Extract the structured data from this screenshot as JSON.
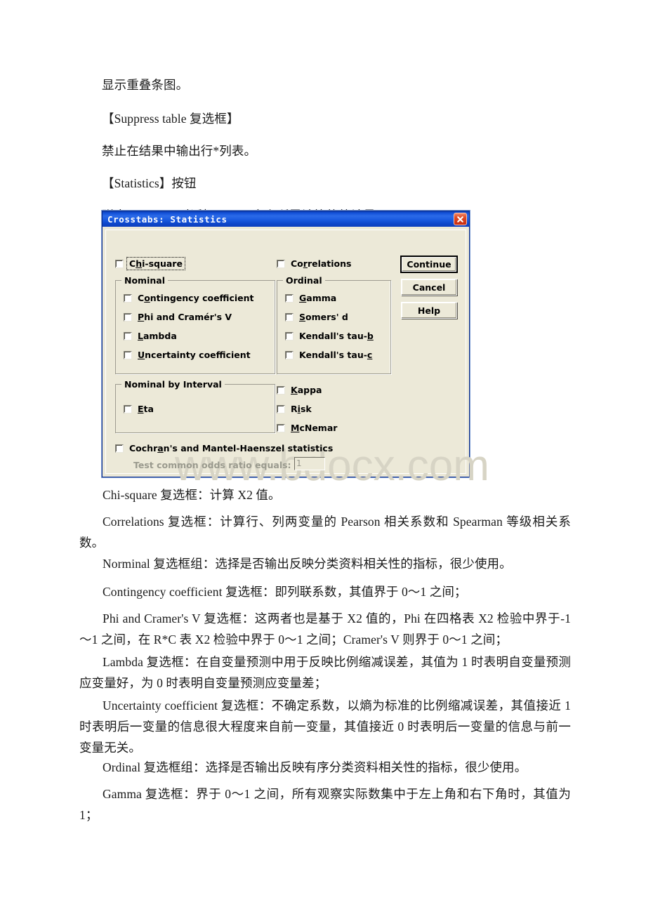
{
  "document": {
    "paragraphs": [
      {
        "text": "显示重叠条图。"
      },
      {
        "text": "【Suppress table 复选框】"
      },
      {
        "text": "禁止在结果中输出行*列表。"
      },
      {
        "text": "【Statistics】按钮"
      },
      {
        "text": "弹出 Statistics 对话框，用于定义所需计算的统计量。"
      },
      {
        "text": "Chi-square 复选框：计算 X2 值。"
      },
      {
        "text": "Correlations 复选框：计算行、列两变量的 Pearson 相关系数和 Spearman 等级相关系数。"
      },
      {
        "text": "Norminal 复选框组：选择是否输出反映分类资料相关性的指标，很少使用。"
      },
      {
        "text": "Contingency coefficient 复选框：即列联系数，其值界于 0～1 之间；"
      },
      {
        "text": "Phi and Cramer's V 复选框：这两者也是基于 X2 值的，Phi 在四格表 X2 检验中界于-1～1 之间，在 R*C 表 X2 检验中界于 0～1 之间；Cramer's V 则界于 0～1 之间；"
      },
      {
        "text": "Lambda 复选框：在自变量预测中用于反映比例缩减误差，其值为 1 时表明自变量预测应变量好，为 0 时表明自变量预测应变量差；"
      },
      {
        "text": "Uncertainty coefficient 复选框：不确定系数，以熵为标准的比例缩减误差，其值接近 1 时表明后一变量的信息很大程度来自前一变量，其值接近 0 时表明后一变量的信息与前一变量无关。"
      },
      {
        "text": "Ordinal 复选框组：选择是否输出反映有序分类资料相关性的指标，很少使用。"
      },
      {
        "text": "Gamma 复选框：界于 0～1 之间，所有观察实际数集中于左上角和右下角时，其值为 1；"
      }
    ]
  },
  "watermark": {
    "text": "www.bdocx.com"
  },
  "dialog": {
    "title": "Crosstabs: Statistics",
    "close_icon": "close-icon",
    "checkboxes": {
      "chi_square": "Chi-square",
      "correlations": "Correlations",
      "kappa": "Kappa",
      "risk": "Risk",
      "mcnemar": "McNemar",
      "cochran": "Cochran's and Mantel-Haenszel statistics"
    },
    "groups": {
      "nominal": {
        "title": "Nominal",
        "items": [
          "Contingency coefficient",
          "Phi and Cramér's V",
          "Lambda",
          "Uncertainty coefficient"
        ]
      },
      "ordinal": {
        "title": "Ordinal",
        "items": [
          "Gamma",
          "Somers' d",
          "Kendall's tau-b",
          "Kendall's tau-c"
        ]
      },
      "nominal_by_interval": {
        "title": "Nominal by Interval",
        "items": [
          "Eta"
        ]
      }
    },
    "odds_ratio": {
      "label": "Test common odds ratio equals:",
      "value": "1"
    },
    "buttons": {
      "continue": "Continue",
      "cancel": "Cancel",
      "help": "Help"
    },
    "colors": {
      "titlebar_blue": "#1452d8",
      "dialog_face": "#ece9d8",
      "close_red": "#e04a25"
    }
  }
}
